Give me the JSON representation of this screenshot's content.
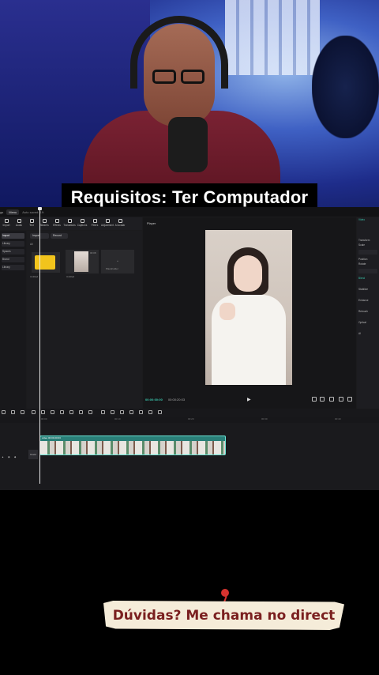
{
  "caption_top": "Requisitos: Ter Computador",
  "caption_bottom": "Dúvidas? Me chama no direct",
  "editor": {
    "topbar": {
      "tab_left": "gs",
      "tab_menu": "Menu",
      "project": "Auto saved: 19:"
    },
    "media_tools": [
      "Import",
      "Audio",
      "Text",
      "Stickers",
      "Effects",
      "Transitions",
      "Captions",
      "Filters",
      "Adjustment",
      "AI avatar"
    ],
    "left_nav": [
      "Import",
      "Library",
      "Spaces",
      "Brand",
      "Library"
    ],
    "media_buttons": {
      "import": "Import",
      "record": "Record"
    },
    "media_sub": "All",
    "media_items": [
      {
        "label": "Untitled"
      },
      {
        "label": "Untitled",
        "duration": "00:08"
      },
      {
        "label": "Placeholder"
      }
    ],
    "player": {
      "title": "Player",
      "time_current": "00:00:00:00",
      "time_total": "00:00:20:03"
    },
    "inspector": [
      "Video",
      "Transform",
      "Scale",
      "Position",
      "Rotate",
      "Blend",
      "Stabilize",
      "Enhance",
      "Retouch",
      "Optical",
      "AI"
    ],
    "ruler_ticks": [
      "00:00",
      "00:10",
      "00:20",
      "00:30",
      "00:40"
    ],
    "track": {
      "cover_label": "Cover",
      "clip_label": "video  00:00:20:03"
    }
  }
}
